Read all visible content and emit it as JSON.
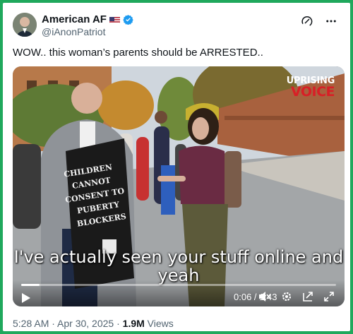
{
  "author": {
    "name": "American AF",
    "flag": "us-flag-emoji",
    "verified": true,
    "handle": "@iAnonPatriot"
  },
  "tweet": {
    "text": "WOW.. this woman’s parents should be ARRESTED.."
  },
  "media": {
    "watermark_top": "UPRISING",
    "watermark_bottom": "VOICE",
    "sign_text": "CHILDREN CANNOT CONSENT TO PUBERTY BLOCKERS",
    "caption": "I've actually seen your stuff online and yeah",
    "time": "0:06 / 1:43",
    "progress": 0.058
  },
  "meta": {
    "time": "5:28 AM · Apr 30, 2025 · ",
    "views_count": "1.9M",
    "views_label": "Views"
  },
  "colors": {
    "background": "#1fa85c",
    "verified": "#1d9bf0",
    "watermark_red": "#d81f26"
  },
  "icons": [
    "grok-icon",
    "more-icon",
    "play-icon",
    "volume-muted-icon",
    "settings-icon",
    "pip-icon",
    "fullscreen-icon"
  ]
}
